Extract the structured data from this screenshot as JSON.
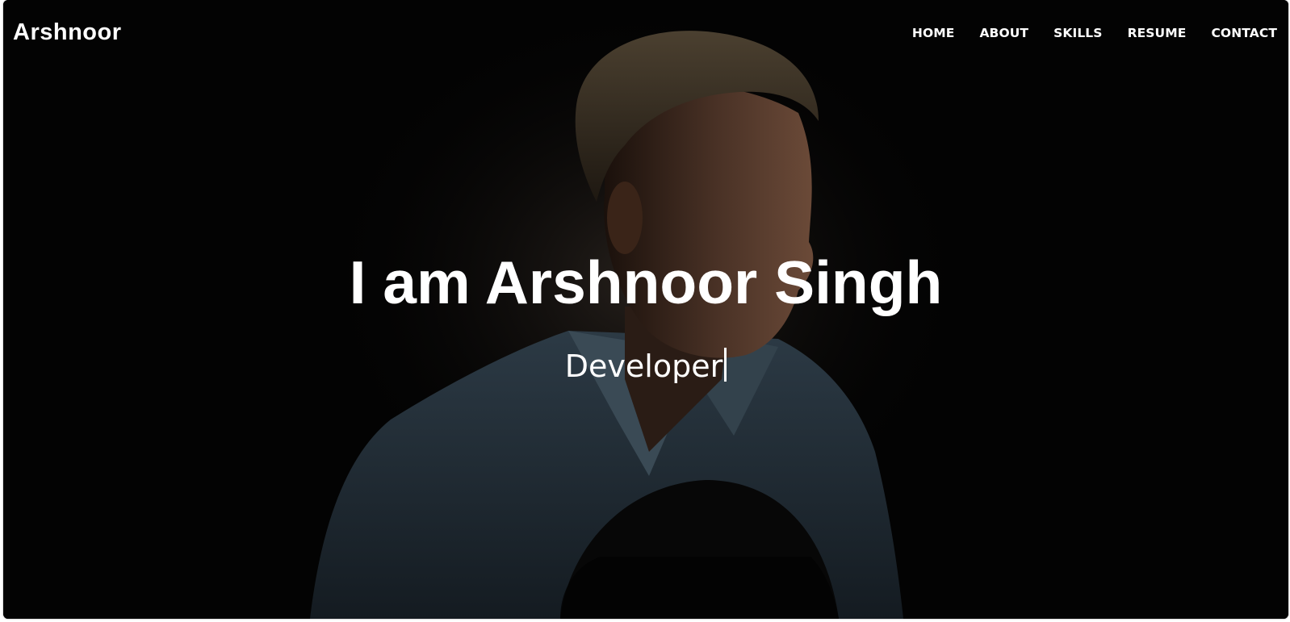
{
  "header": {
    "brand": "Arshnoor",
    "nav": [
      {
        "label": "HOME"
      },
      {
        "label": "ABOUT"
      },
      {
        "label": "SKILLS"
      },
      {
        "label": "RESUME"
      },
      {
        "label": "CONTACT"
      }
    ]
  },
  "hero": {
    "title": "I am Arshnoor Singh",
    "typed_text": "Developer",
    "background_icon": "portrait-photo"
  },
  "colors": {
    "background": "#030303",
    "text": "#ffffff"
  }
}
